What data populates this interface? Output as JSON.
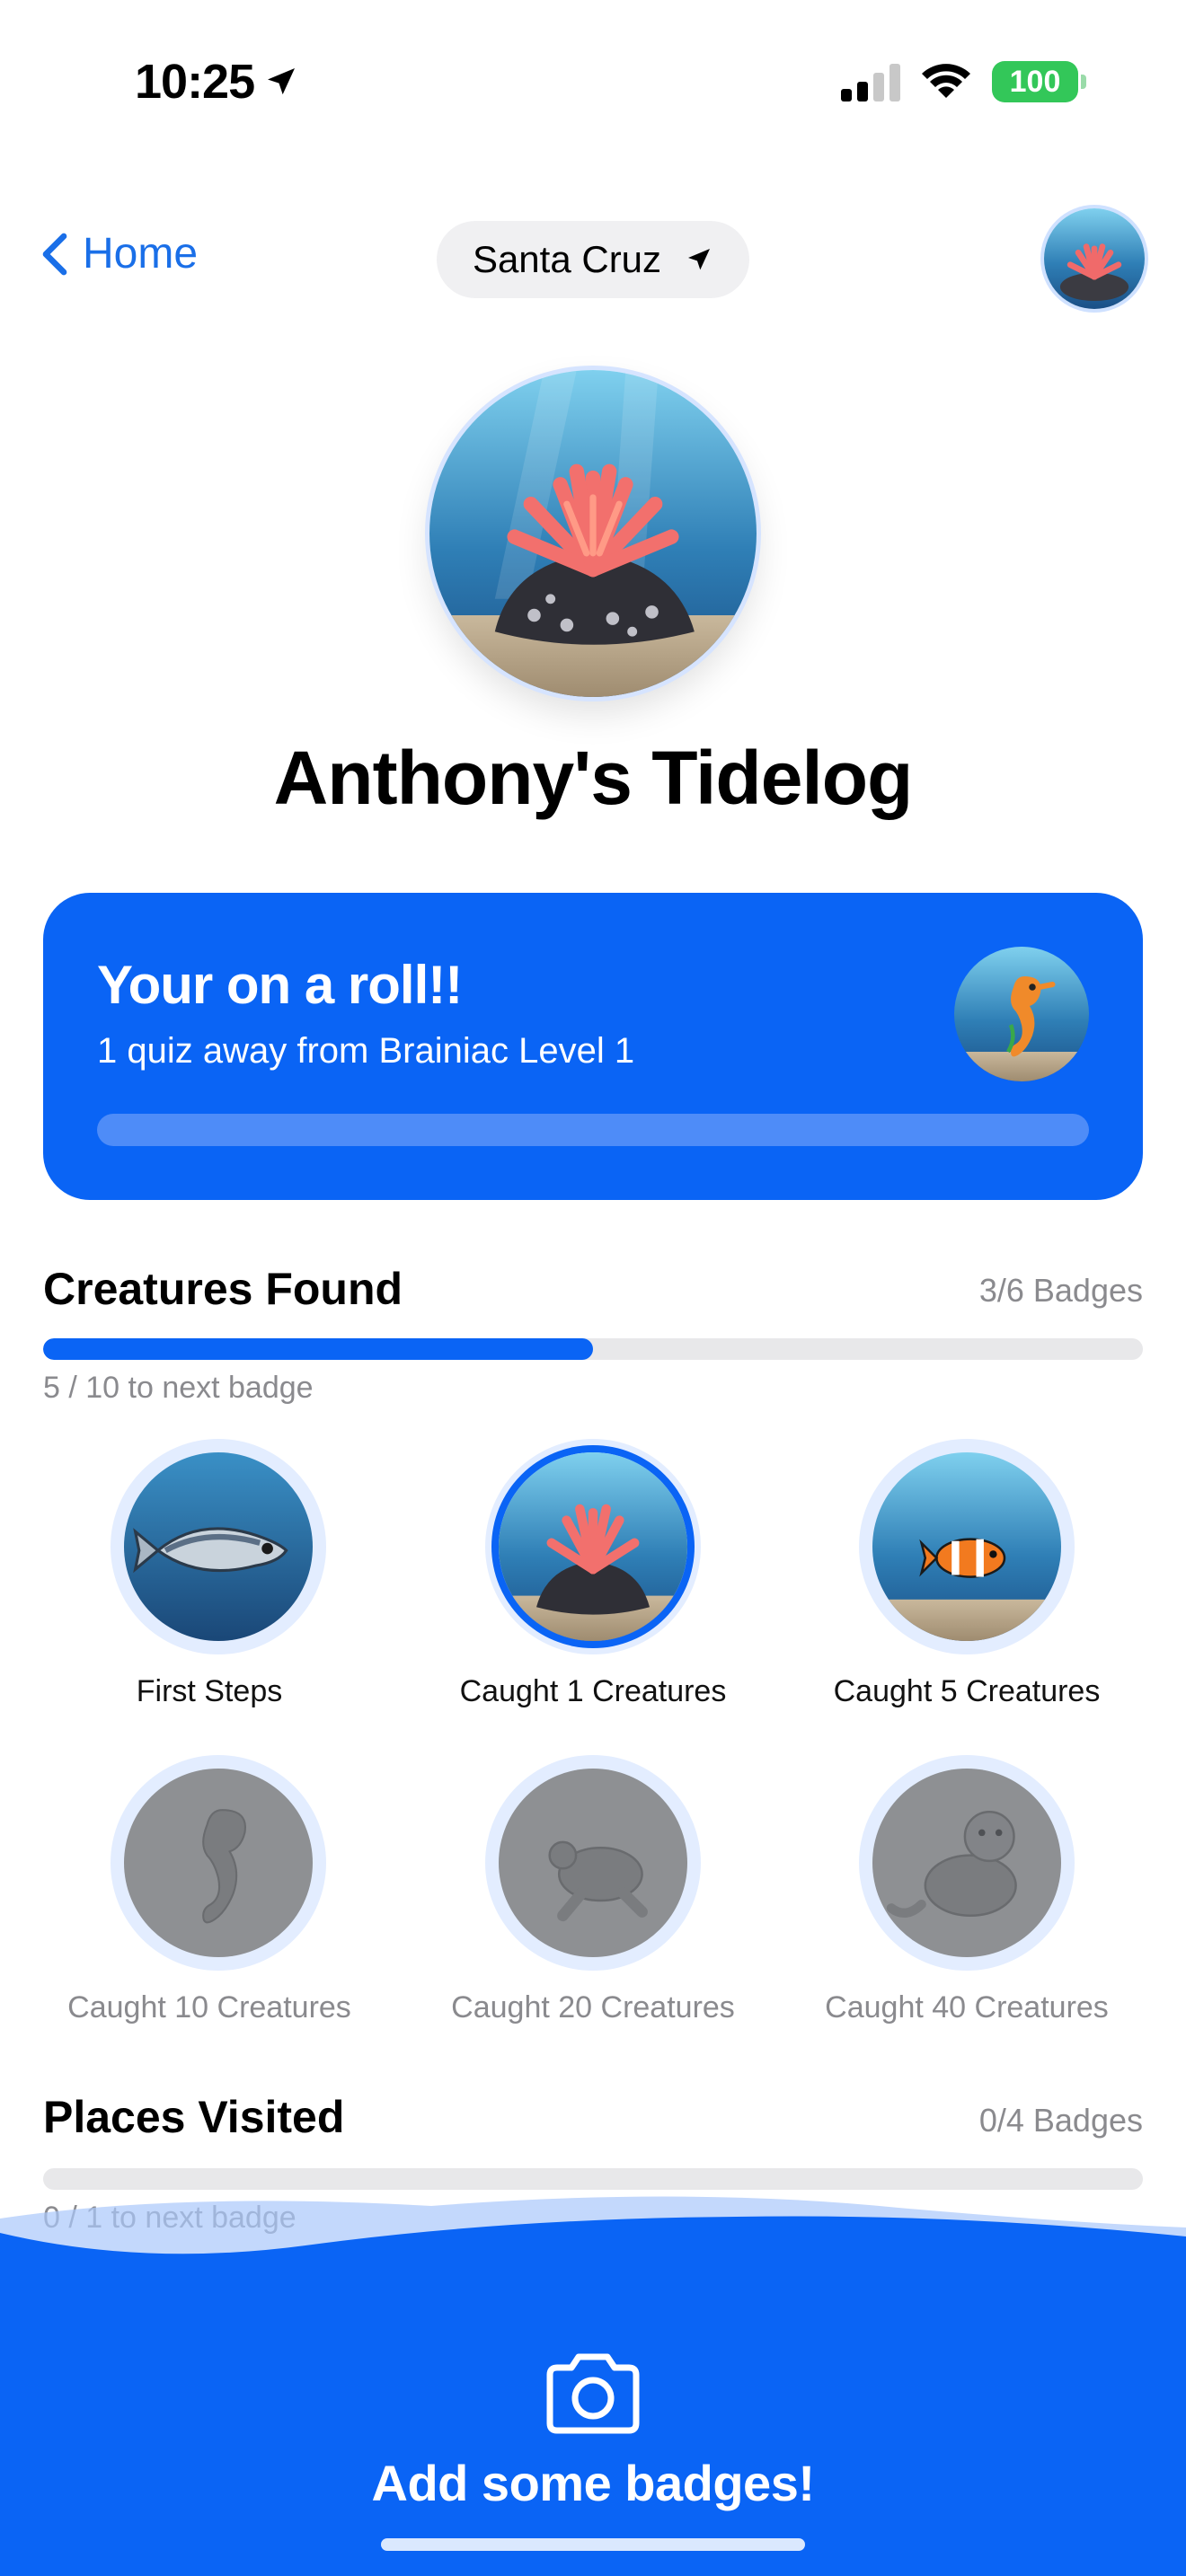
{
  "status_bar": {
    "time": "10:25",
    "battery": "100"
  },
  "nav": {
    "back_label": "Home",
    "location": "Santa Cruz"
  },
  "profile": {
    "title": "Anthony's Tidelog"
  },
  "streak_card": {
    "title": "Your on a roll!!",
    "subtitle": "1 quiz away from Brainiac Level 1",
    "progress": 0
  },
  "creatures": {
    "title": "Creatures Found",
    "count": "3/6 Badges",
    "progress": 0.5,
    "progress_label": "5 / 10 to next badge",
    "badges": [
      {
        "label": "First Steps",
        "icon": "fish-icon",
        "state": "earned"
      },
      {
        "label": "Caught 1 Creatures",
        "icon": "anemone-icon",
        "state": "selected"
      },
      {
        "label": "Caught 5 Creatures",
        "icon": "clownfish-icon",
        "state": "earned"
      },
      {
        "label": "Caught 10 Creatures",
        "icon": "seahorse-icon",
        "state": "locked"
      },
      {
        "label": "Caught 20 Creatures",
        "icon": "sea-turtle-icon",
        "state": "locked"
      },
      {
        "label": "Caught 40 Creatures",
        "icon": "sea-otter-icon",
        "state": "locked"
      }
    ]
  },
  "places": {
    "title": "Places Visited",
    "count": "0/4 Badges",
    "progress": 0,
    "progress_label": "0 / 1 to next badge"
  },
  "cta": {
    "label": "Add some badges!"
  },
  "colors": {
    "accent": "#0a64f5",
    "link": "#1a6fe8",
    "battery": "#33c759"
  }
}
